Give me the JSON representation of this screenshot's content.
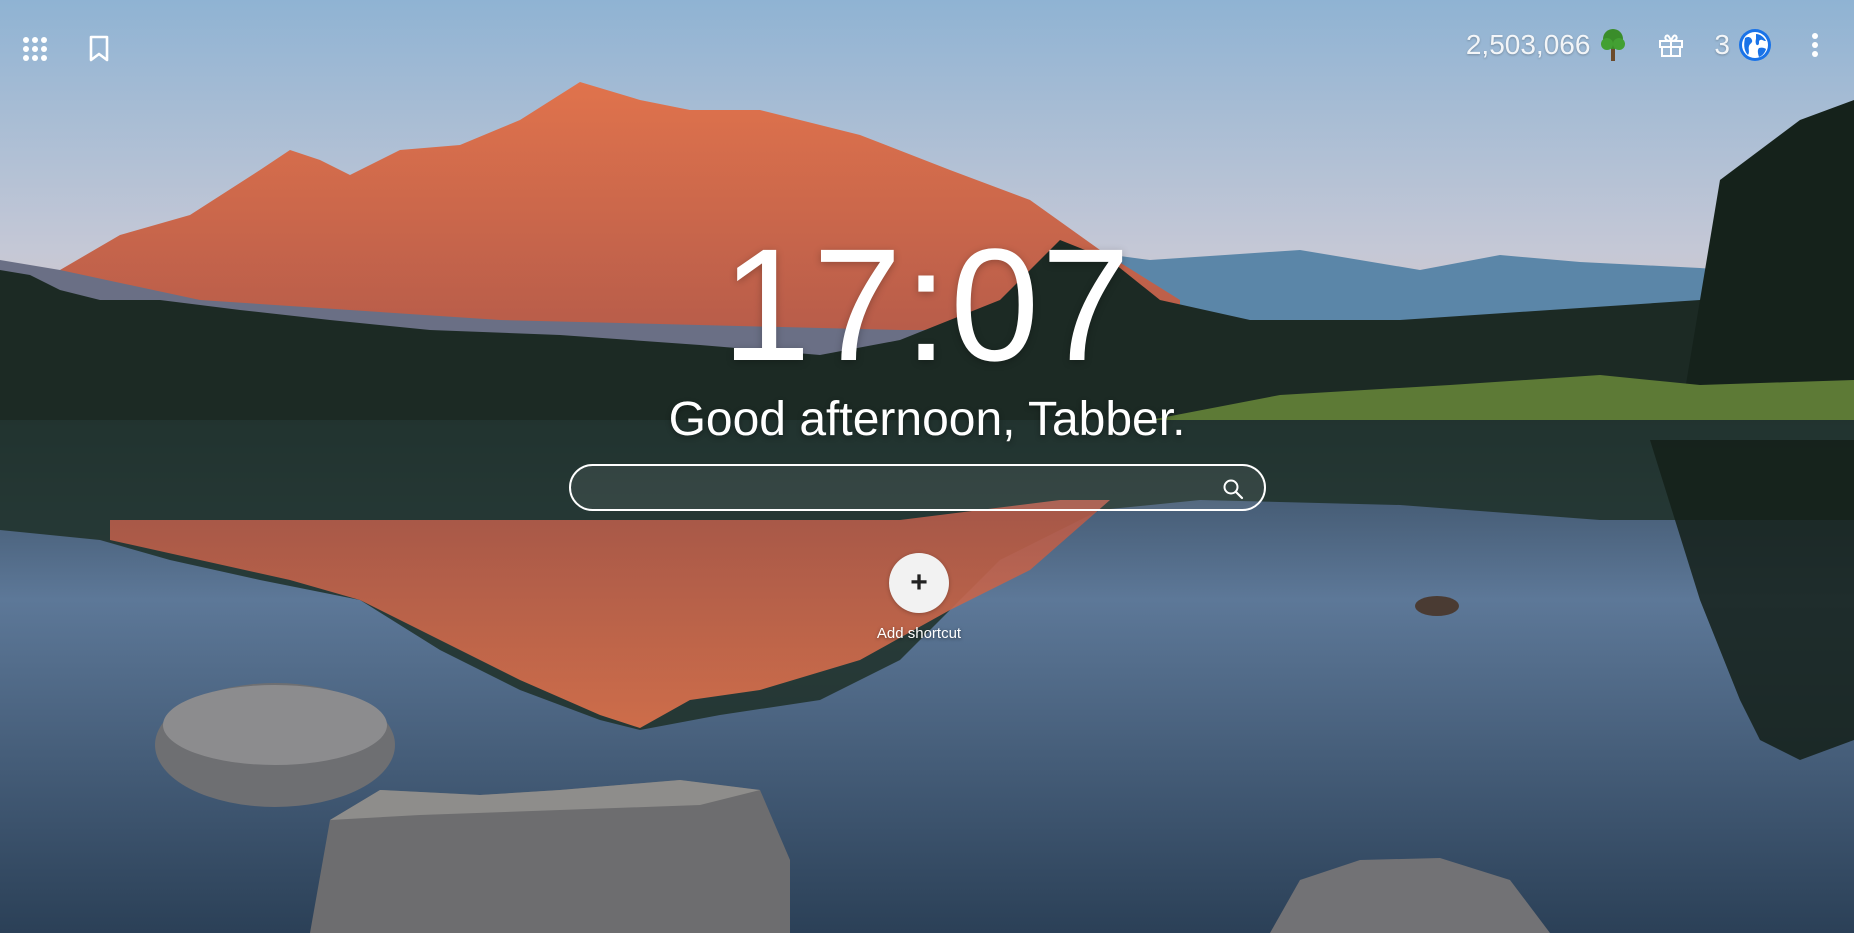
{
  "topbar": {
    "apps_icon": "apps-grid-icon",
    "bookmarks_icon": "bookmark-icon",
    "trees_count": "2,503,066",
    "trees_icon": "tree-icon",
    "gift_icon": "gift-icon",
    "tabs_count": "3",
    "globe_icon": "globe-icon",
    "menu_icon": "more-vertical-icon"
  },
  "main": {
    "clock": "17:07",
    "greeting": "Good afternoon, Tabber.",
    "search": {
      "value": "",
      "placeholder": ""
    },
    "add_shortcut_label": "Add shortcut"
  },
  "colors": {
    "globe": "#1a73e8",
    "tree": "#3a8d2a",
    "foreground": "#ffffff"
  }
}
